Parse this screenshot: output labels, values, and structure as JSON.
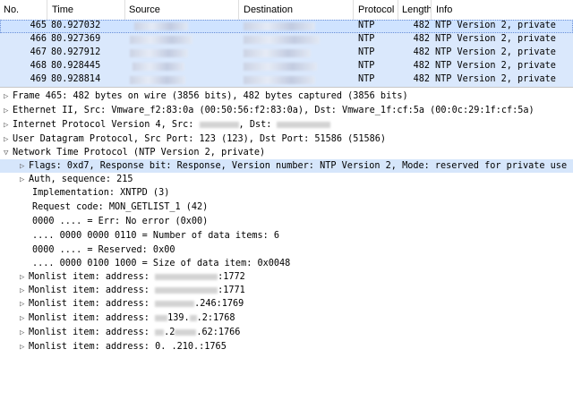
{
  "columns": {
    "no": "No.",
    "time": "Time",
    "source": "Source",
    "destination": "Destination",
    "protocol": "Protocol",
    "length": "Length",
    "info": "Info"
  },
  "packets": [
    {
      "no": "465",
      "time": "80.927032",
      "protocol": "NTP",
      "length": "482",
      "info": "NTP Version 2, private"
    },
    {
      "no": "466",
      "time": "80.927369",
      "protocol": "NTP",
      "length": "482",
      "info": "NTP Version 2, private"
    },
    {
      "no": "467",
      "time": "80.927912",
      "protocol": "NTP",
      "length": "482",
      "info": "NTP Version 2, private"
    },
    {
      "no": "468",
      "time": "80.928445",
      "protocol": "NTP",
      "length": "482",
      "info": "NTP Version 2, private"
    },
    {
      "no": "469",
      "time": "80.928814",
      "protocol": "NTP",
      "length": "482",
      "info": "NTP Version 2, private"
    }
  ],
  "details": {
    "frame": "Frame 465: 482 bytes on wire (3856 bits), 482 bytes captured (3856 bits)",
    "ethernet": "Ethernet II, Src: Vmware_f2:83:0a (00:50:56:f2:83:0a), Dst: Vmware_1f:cf:5a (00:0c:29:1f:cf:5a)",
    "ip_prefix": "Internet Protocol Version 4, Src: ",
    "ip_dst": ", Dst: ",
    "udp": "User Datagram Protocol, Src Port: 123 (123), Dst Port: 51586 (51586)",
    "ntp": "Network Time Protocol (NTP Version 2, private)",
    "flags": "Flags: 0xd7, Response bit: Response, Version number: NTP Version 2, Mode: reserved for private use",
    "auth": "Auth, sequence: 215",
    "implementation": "Implementation: XNTPD (3)",
    "request_code": "Request code: MON_GETLIST_1 (42)",
    "err": "0000 .... = Err: No error (0x00)",
    "num_items": ".... 0000  0000 0110 = Number of data items: 6",
    "reserved": "0000 .... = Reserved: 0x00",
    "size_item": ".... 0000  0100 1000 = Size of data item: 0x0048",
    "monlist_prefix": "Monlist item: address: ",
    "monlist_suffixes": [
      ":1772",
      ":1771",
      ".246:1769",
      ".2:1768",
      ".62:1766",
      ":1765"
    ],
    "monlist_partials": [
      "",
      "",
      "",
      "139.",
      ".2",
      "0.   .210."
    ]
  },
  "colors": {
    "row_bg": "#dae8fc",
    "selected_bg": "#d6e6fb"
  }
}
